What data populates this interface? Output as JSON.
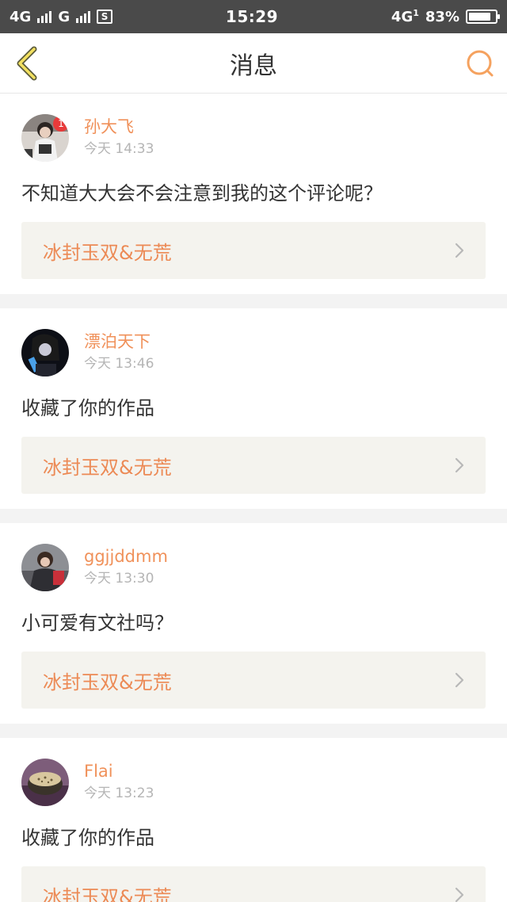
{
  "status_bar": {
    "network1": "4G",
    "network2": "G",
    "sim_icon": "S",
    "time": "15:29",
    "network3": "4G",
    "network3_sup": "1",
    "battery_percent": "83%",
    "battery_level": 0.83
  },
  "header": {
    "title": "消息",
    "back_icon": "back-arrow-icon",
    "search_icon": "search-icon",
    "accent_color": "#f5a25f"
  },
  "messages": [
    {
      "username": "孙大飞",
      "time": "今天 14:33",
      "content": "不知道大大会不会注意到我的这个评论呢？",
      "work_title": "冰封玉双&无荒",
      "badge": "1"
    },
    {
      "username": "漂泊天下",
      "time": "今天 13:46",
      "content": "收藏了你的作品",
      "work_title": "冰封玉双&无荒"
    },
    {
      "username": "ggjjddmm",
      "time": "今天 13:30",
      "content": "小可爱有文社吗？",
      "work_title": "冰封玉双&无荒"
    },
    {
      "username": "Flai",
      "time": "今天 13:23",
      "content": "收藏了你的作品",
      "work_title": "冰封玉双&无荒"
    }
  ]
}
